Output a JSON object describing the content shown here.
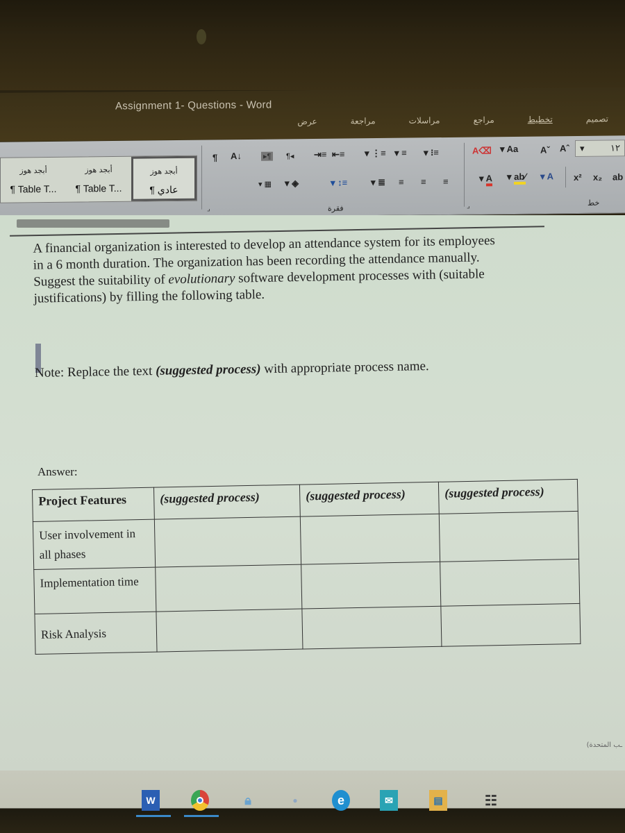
{
  "window": {
    "title": "Assignment 1- Questions - Word"
  },
  "ribbon_tabs": [
    {
      "label": "تصميم",
      "underlined": false
    },
    {
      "label": "تخطيط",
      "underlined": true
    },
    {
      "label": "مراجع",
      "underlined": false
    },
    {
      "label": "مراسلات",
      "underlined": false
    },
    {
      "label": "مراجعة",
      "underlined": false
    },
    {
      "label": "عرض",
      "underlined": false
    }
  ],
  "styles_gallery": [
    {
      "preview": "أبجد هوز",
      "name": "¶ عادي",
      "selected": true
    },
    {
      "preview": "أبجد هوز",
      "name": "¶ Table T...",
      "selected": false
    },
    {
      "preview": "أبجد هوز",
      "name": "¶ Table T...",
      "selected": false
    }
  ],
  "paragraph_group": {
    "label": "فقرة",
    "buttons": [
      "show-formatting-icon",
      "sort-icon",
      "ltr-direction-icon",
      "rtl-direction-icon",
      "increase-indent-icon",
      "decrease-indent-icon",
      "multilevel-list-icon",
      "numbered-list-icon",
      "bullet-list-icon",
      "borders-icon",
      "shading-icon",
      "line-spacing-icon",
      "justify-icon",
      "align-left-icon",
      "center-icon",
      "align-right-icon"
    ]
  },
  "font_group": {
    "label": "خط",
    "font_size": "١٢",
    "change_case": "Aa",
    "shrink_font": "A",
    "grow_font": "A",
    "superscript": "x²",
    "subscript": "x₂",
    "strikethrough": "ab",
    "font_color": "#d8342a",
    "highlight_color": "#f2d422",
    "text_effects": "A",
    "highlight_label": "ab"
  },
  "document": {
    "paragraph": {
      "line1": "A financial organization is interested to develop an attendance system for its employees",
      "line2": "in a 6 month duration. The organization has been recording the attendance manually.",
      "line3_a": "Suggest the suitability of ",
      "line3_em": "evolutionary",
      "line3_b": " software development processes with (suitable",
      "line4": "justifications) by filling the following table."
    },
    "note": {
      "prefix": "Note: Replace the text ",
      "emphasis": "(suggested process)",
      "suffix": " with appropriate process name."
    },
    "answer_label": "Answer:",
    "table": {
      "headers": [
        "Project Features",
        "(suggested process)",
        "(suggested process)",
        "(suggested process)"
      ],
      "rows": [
        {
          "feature": "User involvement in all phases",
          "cells": [
            "",
            "",
            ""
          ]
        },
        {
          "feature": "Implementation time",
          "cells": [
            "",
            "",
            ""
          ]
        },
        {
          "feature": "Risk Analysis",
          "cells": [
            "",
            "",
            ""
          ]
        }
      ]
    }
  },
  "status_bar": {
    "language": "(ـب المتحدة"
  },
  "taskbar": [
    {
      "name": "word",
      "label": "W",
      "color": "#2b5fb3"
    },
    {
      "name": "chrome",
      "label": "",
      "color": "#4caf50"
    },
    {
      "name": "vpn-lock",
      "label": "",
      "color": "#6aa3d0"
    },
    {
      "name": "cortana",
      "label": "",
      "color": "#8fa7c4"
    },
    {
      "name": "edge",
      "label": "",
      "color": "#1f8fd0"
    },
    {
      "name": "mail",
      "label": "",
      "color": "#2aa3b4"
    },
    {
      "name": "file-explorer",
      "label": "",
      "color": "#e3b24a"
    },
    {
      "name": "task-view",
      "label": "",
      "color": "#333333"
    }
  ]
}
